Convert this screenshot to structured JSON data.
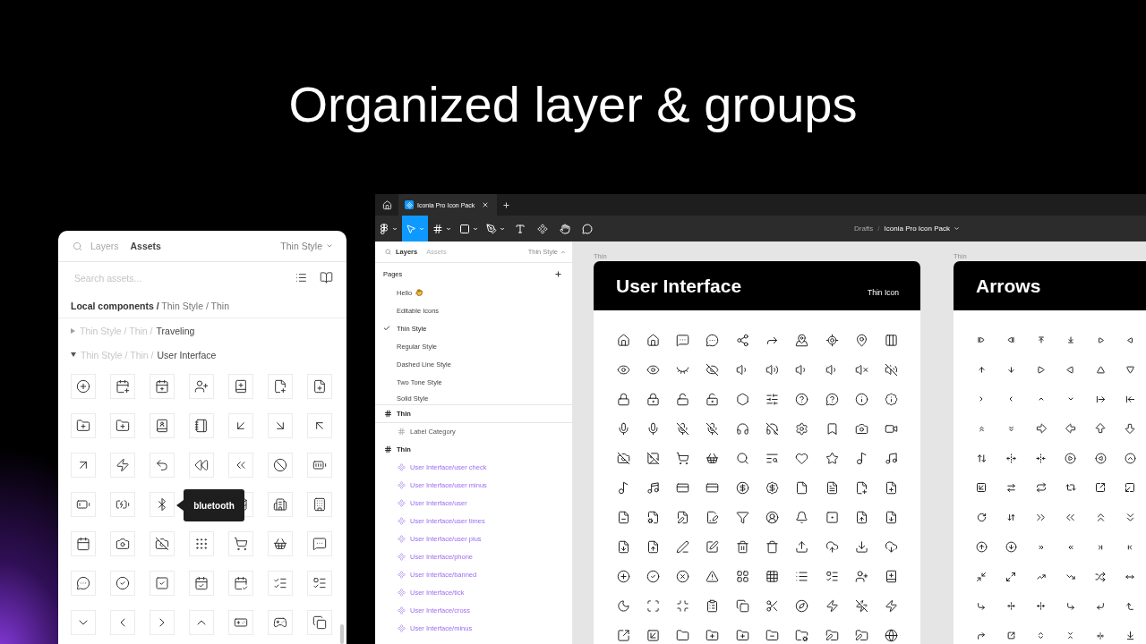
{
  "headline": "Organized layer & groups",
  "assets_panel": {
    "tabs": [
      {
        "label": "Layers",
        "selected": false
      },
      {
        "label": "Assets",
        "selected": true
      }
    ],
    "page_menu": {
      "label": "Thin Style",
      "expanded": false
    },
    "search": {
      "placeholder": "Search assets..."
    },
    "breadcrumb": "**Local components /** Thin Style / Thin",
    "groups": [
      {
        "path": "Thin Style / Thin /",
        "name": "Traveling",
        "expanded": false
      },
      {
        "path": "Thin Style / Thin /",
        "name": "User Interface",
        "expanded": true
      }
    ],
    "tooltip": "bluetooth"
  },
  "editor": {
    "tabs": [
      {
        "title": "Iconia Pro Icon Pack",
        "selected": true
      }
    ],
    "tools": [
      {
        "kind": "main-menu",
        "selected": false,
        "dropdown": true
      },
      {
        "kind": "move",
        "selected": true,
        "dropdown": true
      },
      {
        "kind": "frame",
        "selected": false,
        "dropdown": true
      },
      {
        "kind": "shape",
        "selected": false,
        "dropdown": true
      },
      {
        "kind": "pen",
        "selected": false,
        "dropdown": true
      },
      {
        "kind": "text",
        "selected": false,
        "dropdown": false
      },
      {
        "kind": "resources",
        "selected": false,
        "dropdown": false
      },
      {
        "kind": "hand",
        "selected": false,
        "dropdown": false
      },
      {
        "kind": "comment",
        "selected": false,
        "dropdown": false
      }
    ],
    "file_path": {
      "folder": "Drafts",
      "separator": "/",
      "file": "Iconia Pro Icon Pack"
    },
    "layers_panel": {
      "tabs": [
        {
          "label": "Layers",
          "selected": true
        },
        {
          "label": "Assets",
          "selected": false
        }
      ],
      "page_menu": {
        "label": "Thin Style",
        "expanded": true
      },
      "pages_heading": "Pages",
      "pages": [
        {
          "name": "Hello",
          "kind": "greeting",
          "selected": false
        },
        {
          "name": "Editable Icons",
          "kind": "plain",
          "selected": false
        },
        {
          "name": "Thin Style",
          "kind": "plain",
          "selected": true
        },
        {
          "name": "Regular Style",
          "kind": "plain",
          "selected": false
        },
        {
          "name": "Dashed Line Style",
          "kind": "plain",
          "selected": false
        },
        {
          "name": "Two Tone Style",
          "kind": "plain",
          "selected": false
        },
        {
          "name": "Solid Style",
          "kind": "plain",
          "selected": false
        }
      ],
      "layers": [
        {
          "kind": "frame",
          "name": "Thin",
          "sticky": true,
          "children": [
            {
              "kind": "frame",
              "name": "Label Category"
            }
          ]
        },
        {
          "kind": "frame",
          "name": "Thin",
          "sticky": false,
          "children": [
            {
              "kind": "component",
              "name": "User Interface/user check"
            },
            {
              "kind": "component",
              "name": "User Interface/user minus"
            },
            {
              "kind": "component",
              "name": "User Interface/user"
            },
            {
              "kind": "component",
              "name": "User Interface/user times"
            },
            {
              "kind": "component",
              "name": "User Interface/user plus"
            },
            {
              "kind": "component",
              "name": "User Interface/phone"
            },
            {
              "kind": "component",
              "name": "User Interface/banned"
            },
            {
              "kind": "component",
              "name": "User Interface/tick"
            },
            {
              "kind": "component",
              "name": "User Interface/cross"
            },
            {
              "kind": "component",
              "name": "User Interface/minus"
            }
          ]
        }
      ]
    },
    "canvas": {
      "frames": [
        {
          "kind": "user-interface",
          "label": "Thin",
          "title": "User Interface",
          "subtitle": "Thin Icon"
        },
        {
          "kind": "arrows",
          "label": "Thin",
          "title": "Arrows"
        }
      ]
    }
  }
}
